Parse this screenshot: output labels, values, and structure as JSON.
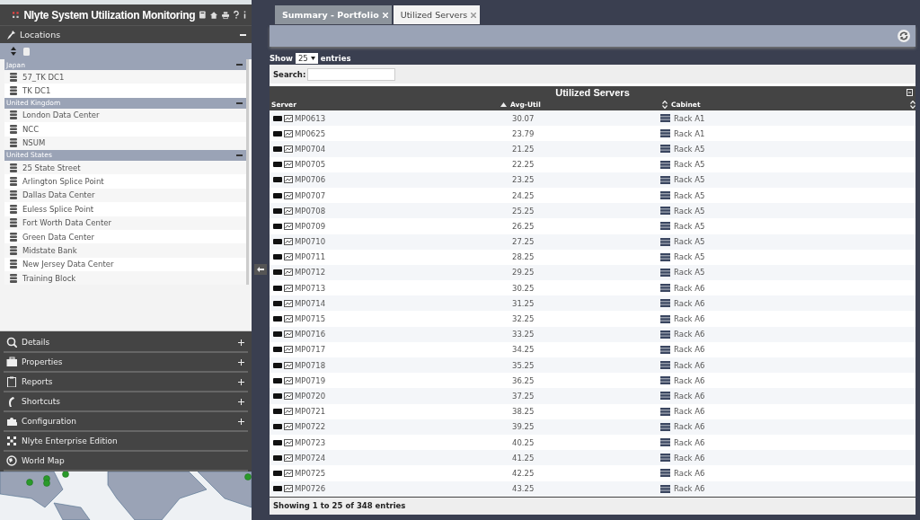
{
  "app": {
    "title": "Nlyte System Utilization Monitoring"
  },
  "locations": {
    "title": "Locations",
    "expanded": true,
    "groups": [
      {
        "name": "Japan",
        "expanded": true,
        "items": [
          "57_TK DC1",
          "TK DC1"
        ]
      },
      {
        "name": "United Kingdom",
        "expanded": true,
        "items": [
          "London Data Center",
          "NCC",
          "NSUM"
        ]
      },
      {
        "name": "United States",
        "expanded": true,
        "items": [
          "25 State Street",
          "Arlington Splice Point",
          "Dallas Data Center",
          "Euless Splice Point",
          "Fort Worth Data Center",
          "Green Data Center",
          "Midstate Bank",
          "New Jersey Data Center",
          "Training Block"
        ]
      }
    ]
  },
  "panels": [
    {
      "label": "Details",
      "kind": "panel",
      "expanded": false
    },
    {
      "label": "Properties",
      "kind": "panel",
      "expanded": false
    },
    {
      "label": "Reports",
      "kind": "panel",
      "expanded": false
    },
    {
      "label": "Shortcuts",
      "kind": "panel",
      "expanded": false
    },
    {
      "label": "Configuration",
      "kind": "panel",
      "expanded": false
    },
    {
      "label": "Nlyte Enterprise Edition",
      "kind": "link"
    },
    {
      "label": "World Map",
      "kind": "panel",
      "expanded": true
    }
  ],
  "tabs": [
    {
      "label": "Summary - Portfolio",
      "selected": false
    },
    {
      "label": "Utilized Servers",
      "selected": true
    }
  ],
  "table": {
    "show_label": "Show",
    "page_size": "25",
    "entries_label": "entries",
    "search_label": "Search:",
    "title": "Utilized Servers",
    "columns": [
      {
        "label": "Server",
        "sortable": false,
        "sorted": false
      },
      {
        "label": "Avg-Util",
        "sortable": true,
        "sorted": true
      },
      {
        "label": "Cabinet",
        "sortable": true,
        "sorted": false
      }
    ],
    "rows": [
      [
        "MP0613",
        "30.07",
        "Rack A1"
      ],
      [
        "MP0625",
        "23.79",
        "Rack A1"
      ],
      [
        "MP0704",
        "21.25",
        "Rack A5"
      ],
      [
        "MP0705",
        "22.25",
        "Rack A5"
      ],
      [
        "MP0706",
        "23.25",
        "Rack A5"
      ],
      [
        "MP0707",
        "24.25",
        "Rack A5"
      ],
      [
        "MP0708",
        "25.25",
        "Rack A5"
      ],
      [
        "MP0709",
        "26.25",
        "Rack A5"
      ],
      [
        "MP0710",
        "27.25",
        "Rack A5"
      ],
      [
        "MP0711",
        "28.25",
        "Rack A5"
      ],
      [
        "MP0712",
        "29.25",
        "Rack A5"
      ],
      [
        "MP0713",
        "30.25",
        "Rack A6"
      ],
      [
        "MP0714",
        "31.25",
        "Rack A6"
      ],
      [
        "MP0715",
        "32.25",
        "Rack A6"
      ],
      [
        "MP0716",
        "33.25",
        "Rack A6"
      ],
      [
        "MP0717",
        "34.25",
        "Rack A6"
      ],
      [
        "MP0718",
        "35.25",
        "Rack A6"
      ],
      [
        "MP0719",
        "36.25",
        "Rack A6"
      ],
      [
        "MP0720",
        "37.25",
        "Rack A6"
      ],
      [
        "MP0721",
        "38.25",
        "Rack A6"
      ],
      [
        "MP0722",
        "39.25",
        "Rack A6"
      ],
      [
        "MP0723",
        "40.25",
        "Rack A6"
      ],
      [
        "MP0724",
        "41.25",
        "Rack A6"
      ],
      [
        "MP0725",
        "42.25",
        "Rack A6"
      ],
      [
        "MP0726",
        "43.25",
        "Rack A6"
      ]
    ],
    "footer": "Showing 1 to 25 of 348 entries"
  }
}
